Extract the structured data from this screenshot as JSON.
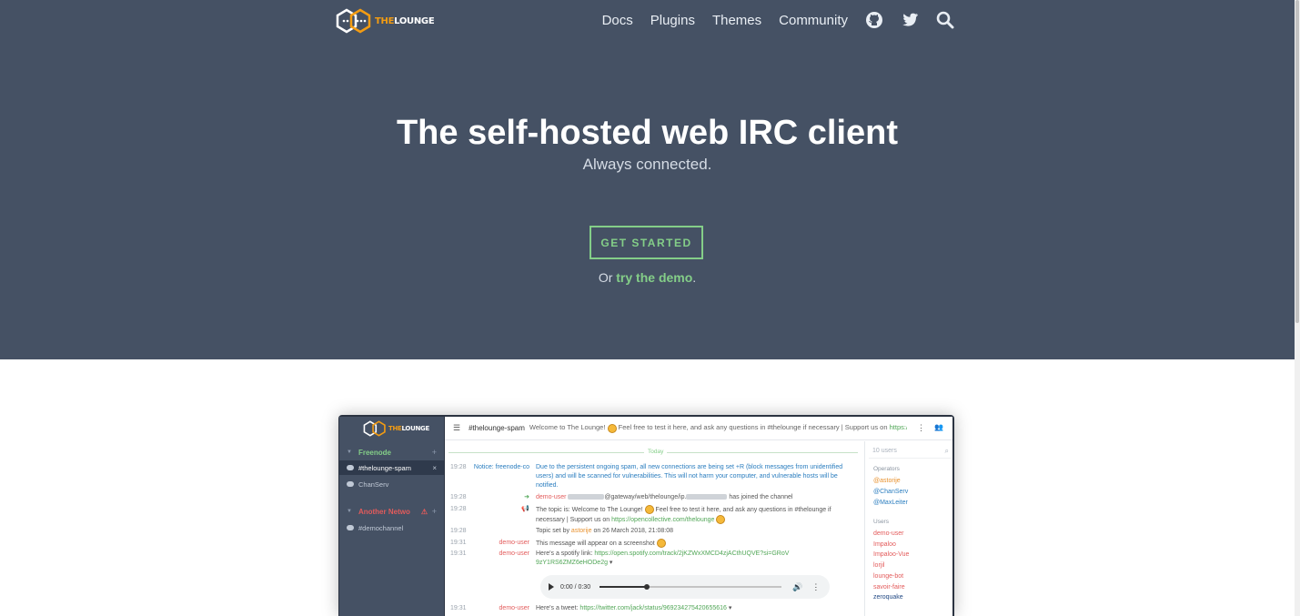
{
  "brand": {
    "name_prefix": "THE",
    "name_suffix": "LOUNGE",
    "orange": "#f39c12"
  },
  "nav": {
    "links": [
      "Docs",
      "Plugins",
      "Themes",
      "Community"
    ],
    "icons": [
      "github-icon",
      "twitter-icon",
      "search-icon"
    ]
  },
  "hero": {
    "title": "The self-hosted web IRC client",
    "subtitle": "Always connected.",
    "cta_label": "GET STARTED",
    "demo_prefix": "Or ",
    "demo_link": "try the demo",
    "demo_suffix": ".",
    "bg_color": "#455164",
    "accent_color": "#84ce88"
  },
  "app": {
    "networks": [
      {
        "name": "Freenode",
        "channels": [
          "#thelounge-spam",
          "ChanServ"
        ]
      },
      {
        "name": "Another Netwo",
        "channels": [
          "#demochannel"
        ]
      }
    ],
    "topbar": {
      "channel": "#thelounge-spam",
      "topic_text": "Welcome to The Lounge!",
      "topic_rest": "Feel free to test it here, and ask any questions in #thelounge if necessary | Support us on",
      "topic_link": "https://op"
    },
    "today_label": "Today",
    "messages": [
      {
        "time": "19:28",
        "from": "Notice: freenode-co",
        "text": "Due to the persistent ongoing spam, all new connections are being set +R (block messages from unidentified users) and will be scanned for vulnerabilities. This will not harm your computer, and vulnerable hosts will be notified."
      },
      {
        "time": "19:28",
        "from": "demo-user",
        "text_pre": "",
        "text_mid": "@gateway/web/thelounge/ip.",
        "text_post": "has joined the channel"
      },
      {
        "time": "19:28",
        "text_pre": "The topic is: Welcome to The Lounge!",
        "text_mid": "Feel free to test it here, and ask any questions in #thelounge if necessary | Support us on",
        "link": "https://opencollective.com/thelounge"
      },
      {
        "time": "19:28",
        "text_pre": "Topic set by",
        "nick": "astorije",
        "text_post": "on 26 March 2018, 21:08:08"
      },
      {
        "time": "19:31",
        "from": "demo-user",
        "text": "This message will appear on a screenshot"
      },
      {
        "time": "19:31",
        "from": "demo-user",
        "text": "Here's a spotify link:",
        "link": "https://open.spotify.com/track/2jKZWxXMCD4zjACthUQVE?si=GRoV9zY1RS6ZMZ6eHODe2g"
      },
      {
        "time": "19:31",
        "from": "demo-user",
        "text": "Here's a tweet:",
        "link": "https://twitter.com/jack/status/969234275420655616"
      }
    ],
    "audio": {
      "time": "0:00 / 0:30",
      "progress": 0.26
    },
    "userlist": {
      "search_placeholder": "10 users",
      "operators_label": "Operators",
      "operators": [
        "@astorije",
        "@ChanServ",
        "@MaxLeiter"
      ],
      "users_label": "Users",
      "users": [
        "demo-user",
        "Impaloo",
        "Impaloo-Vue",
        "lorjil",
        "lounge-bot",
        "savoir-faire",
        "zeroquake"
      ]
    }
  }
}
